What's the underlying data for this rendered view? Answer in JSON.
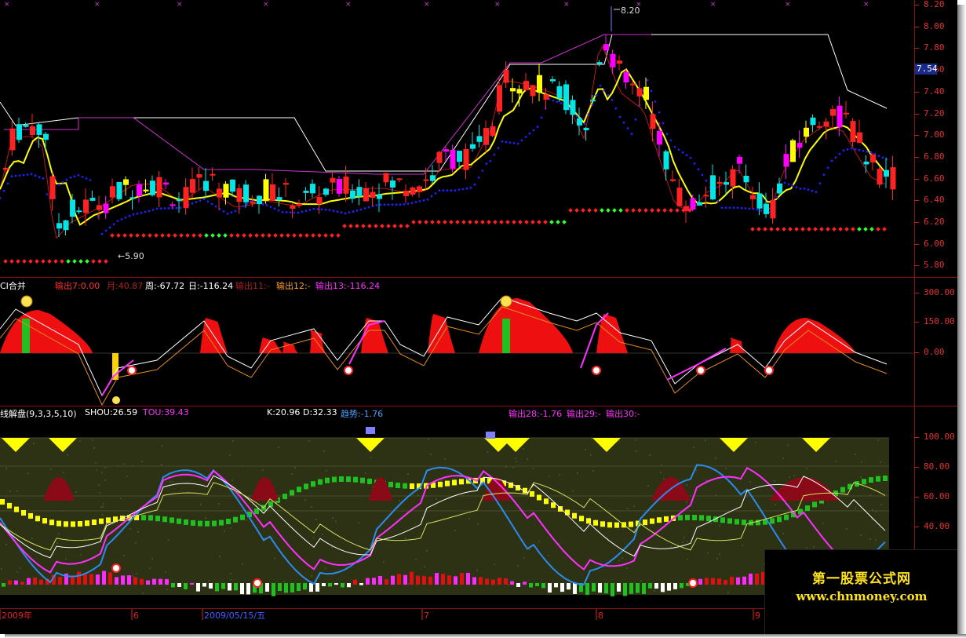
{
  "price_panel": {
    "axis_ticks": [
      "8.20",
      "8.00",
      "7.80",
      "7.60",
      "7.40",
      "7.20",
      "7.00",
      "6.80",
      "6.60",
      "6.40",
      "6.20",
      "6.00",
      "5.80"
    ],
    "current_price": "7.54",
    "high_marker": "8.20",
    "low_marker": "5.90",
    "colors": {
      "up": "#ff2222",
      "down": "#00e5e5",
      "special": "#ff00ff",
      "ma_yellow": "#ffff00",
      "ma_blue": "#2020ff",
      "stop_red": "#ff2020",
      "stop_green": "#30ff30"
    }
  },
  "ci_panel": {
    "title": "CI合并",
    "outputs": [
      {
        "text": "输出7:0.00",
        "color": "#ff3030"
      },
      {
        "text": "月:40.87",
        "color": "#aa2020"
      },
      {
        "text": "周:-67.72",
        "color": "#ffffff"
      },
      {
        "text": "日:-116.24",
        "color": "#ffffff"
      },
      {
        "text": "输出11:-",
        "color": "#aa2020"
      },
      {
        "text": "输出12:-",
        "color": "#ff9a30"
      },
      {
        "text": "输出13:-116.24",
        "color": "#ff30ff"
      }
    ],
    "axis_ticks": [
      "300.00",
      "150.00",
      "0.00"
    ]
  },
  "kd_panel": {
    "title": "线解盘(9,3,3,5,10)",
    "outputs": [
      {
        "text": "SHOU:26.59",
        "color": "#ffffff"
      },
      {
        "text": "TOU:39.43",
        "color": "#ff30ff"
      },
      {
        "text": "K:20.96",
        "color": "#ffffff"
      },
      {
        "text": "D:32.33",
        "color": "#ffffff"
      },
      {
        "text": "趋势:-1.76",
        "color": "#4aa0ff"
      },
      {
        "text": "输出28:-1.76",
        "color": "#ff30ff"
      },
      {
        "text": "输出29:-",
        "color": "#ff30ff"
      },
      {
        "text": "输出30:-",
        "color": "#ff30ff"
      }
    ],
    "axis_ticks": [
      "100.00",
      "80.00",
      "60.00",
      "40.00"
    ]
  },
  "date_bar": {
    "labels": [
      "2009年",
      "6",
      "2009/05/15/五",
      "7",
      "8",
      "9"
    ]
  },
  "watermark": {
    "title": "第一股票公式网",
    "url": "www.chnmoney.com"
  }
}
